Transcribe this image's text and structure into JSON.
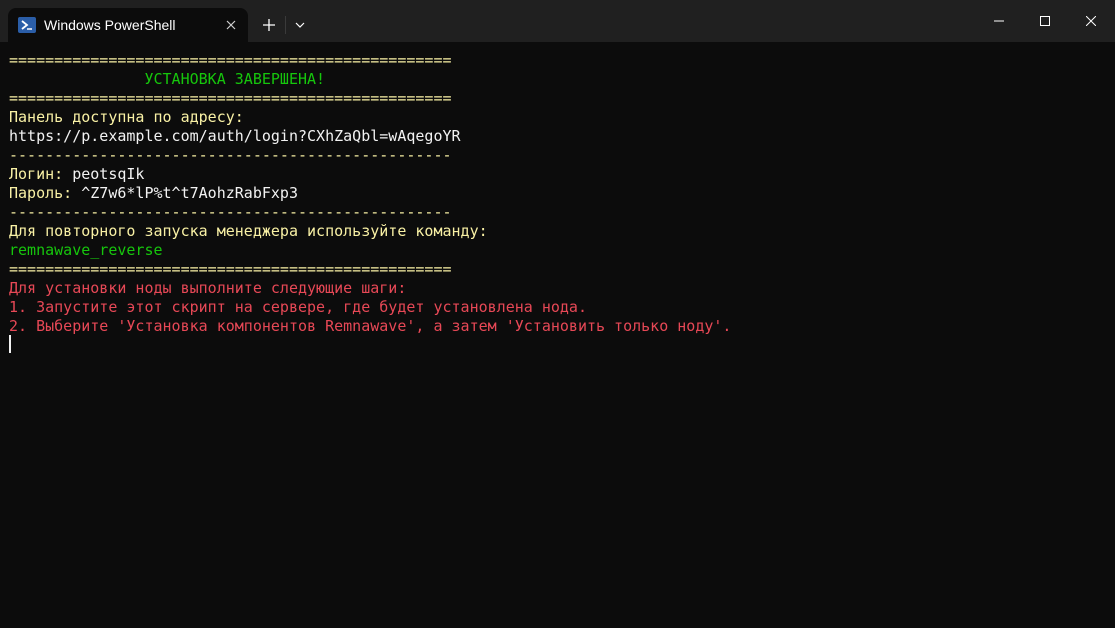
{
  "window": {
    "tab_title": "Windows PowerShell",
    "icons": {
      "tab": "powershell-icon",
      "close_tab": "close-icon",
      "new_tab": "plus-icon",
      "dropdown": "chevron-down-icon",
      "minimize": "minimize-icon",
      "maximize": "maximize-icon",
      "close": "close-icon"
    }
  },
  "terminal": {
    "colors": {
      "background": "#0c0c0c",
      "yellow": "#f9f1a5",
      "white": "#f2f2f2",
      "green": "#16c60c",
      "red": "#e74856"
    },
    "lines": [
      "=================================================",
      "               УСТАНОВКА ЗАВЕРШЕНА!",
      "=================================================",
      "Панель доступна по адресу:",
      "https://p.example.com/auth/login?CXhZaQbl=wAqegoYR",
      "-------------------------------------------------",
      "Логин: ",
      "peotsqIk",
      "Пароль: ",
      "^Z7w6*lP%t^t7AohzRabFxp3",
      "-------------------------------------------------",
      "Для повторного запуска менеджера используйте команду:",
      "remnawave_reverse",
      "=================================================",
      "Для установки ноды выполните следующие шаги:",
      "1. Запустите этот скрипт на сервере, где будет установлена нода.",
      "2. Выберите 'Установка компонентов Remnawave', а затем 'Установить только ноду'."
    ]
  }
}
